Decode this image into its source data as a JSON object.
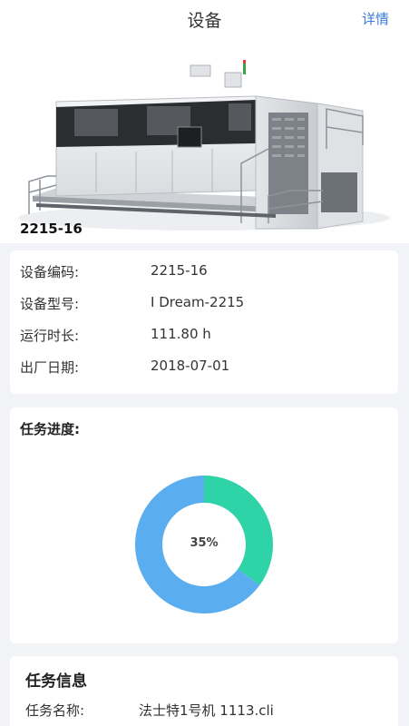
{
  "header": {
    "title": "设备",
    "detail_link": "详情"
  },
  "hero": {
    "image_icon": "machine-photo",
    "caption": "2215-16"
  },
  "device_info": {
    "rows": [
      {
        "label": "设备编码:",
        "value": "2215-16"
      },
      {
        "label": "设备型号:",
        "value": "I Dream-2215"
      },
      {
        "label": "运行时长:",
        "value": "111.80 h"
      },
      {
        "label": "出厂日期:",
        "value": "2018-07-01"
      }
    ]
  },
  "progress": {
    "heading": "任务进度:",
    "percent_label": "35%",
    "chart_data": {
      "type": "pie",
      "values": [
        35,
        65
      ],
      "colors": [
        "#2fd3a8",
        "#5aaef0"
      ]
    }
  },
  "task": {
    "heading": "任务信息",
    "rows": [
      {
        "label": "任务名称:",
        "value": "法士特1号机 1113.cli"
      }
    ]
  }
}
